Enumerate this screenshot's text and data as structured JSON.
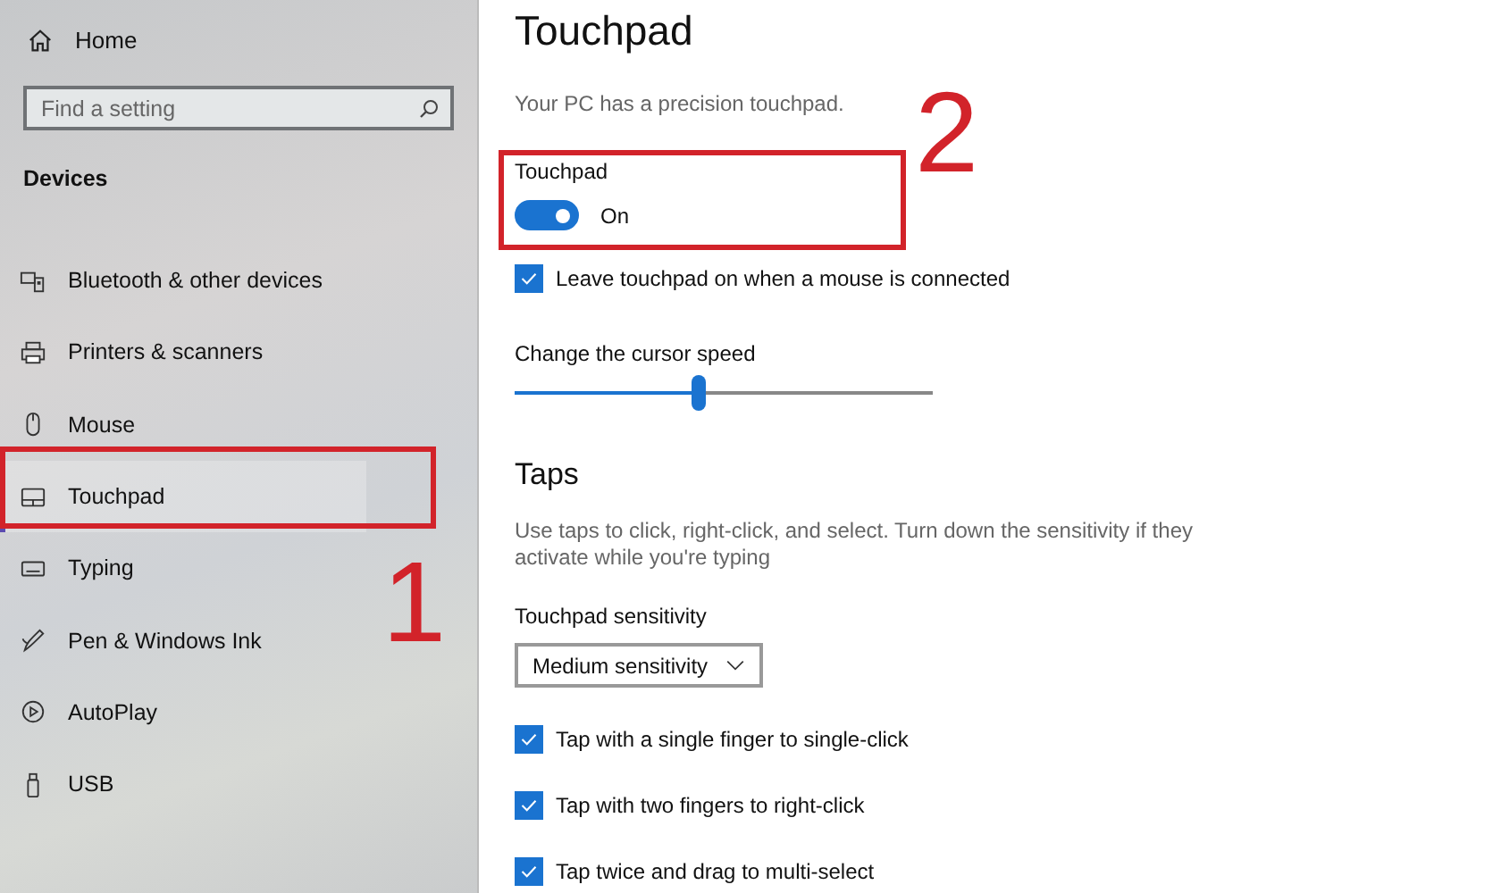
{
  "sidebar": {
    "home": "Home",
    "search": {
      "placeholder": "Find a setting"
    },
    "section": "Devices",
    "items": [
      {
        "label": "Bluetooth & other devices",
        "selected": false
      },
      {
        "label": "Printers & scanners",
        "selected": false
      },
      {
        "label": "Mouse",
        "selected": false
      },
      {
        "label": "Touchpad",
        "selected": true
      },
      {
        "label": "Typing",
        "selected": false
      },
      {
        "label": "Pen & Windows Ink",
        "selected": false
      },
      {
        "label": "AutoPlay",
        "selected": false
      },
      {
        "label": "USB",
        "selected": false
      }
    ]
  },
  "page": {
    "title": "Touchpad",
    "description": "Your PC has a precision touchpad.",
    "touchpad": {
      "label": "Touchpad",
      "on": true,
      "state_text": "On"
    },
    "leave_on": {
      "label": "Leave touchpad on when a mouse is connected",
      "checked": true
    },
    "cursor_speed": {
      "label": "Change the cursor speed",
      "level": 0.44
    },
    "taps": {
      "heading": "Taps",
      "description": "Use taps to click, right-click, and select. Turn down the sensitivity if they activate while you're typing",
      "sensitivity_label": "Touchpad sensitivity",
      "sensitivity_value": "Medium sensitivity",
      "options": [
        {
          "label": "Tap with a single finger to single-click",
          "checked": true
        },
        {
          "label": "Tap with two fingers to right-click",
          "checked": true
        },
        {
          "label": "Tap twice and drag to multi-select",
          "checked": true
        }
      ]
    }
  },
  "annotations": [
    {
      "label": "1"
    },
    {
      "label": "2"
    }
  ]
}
